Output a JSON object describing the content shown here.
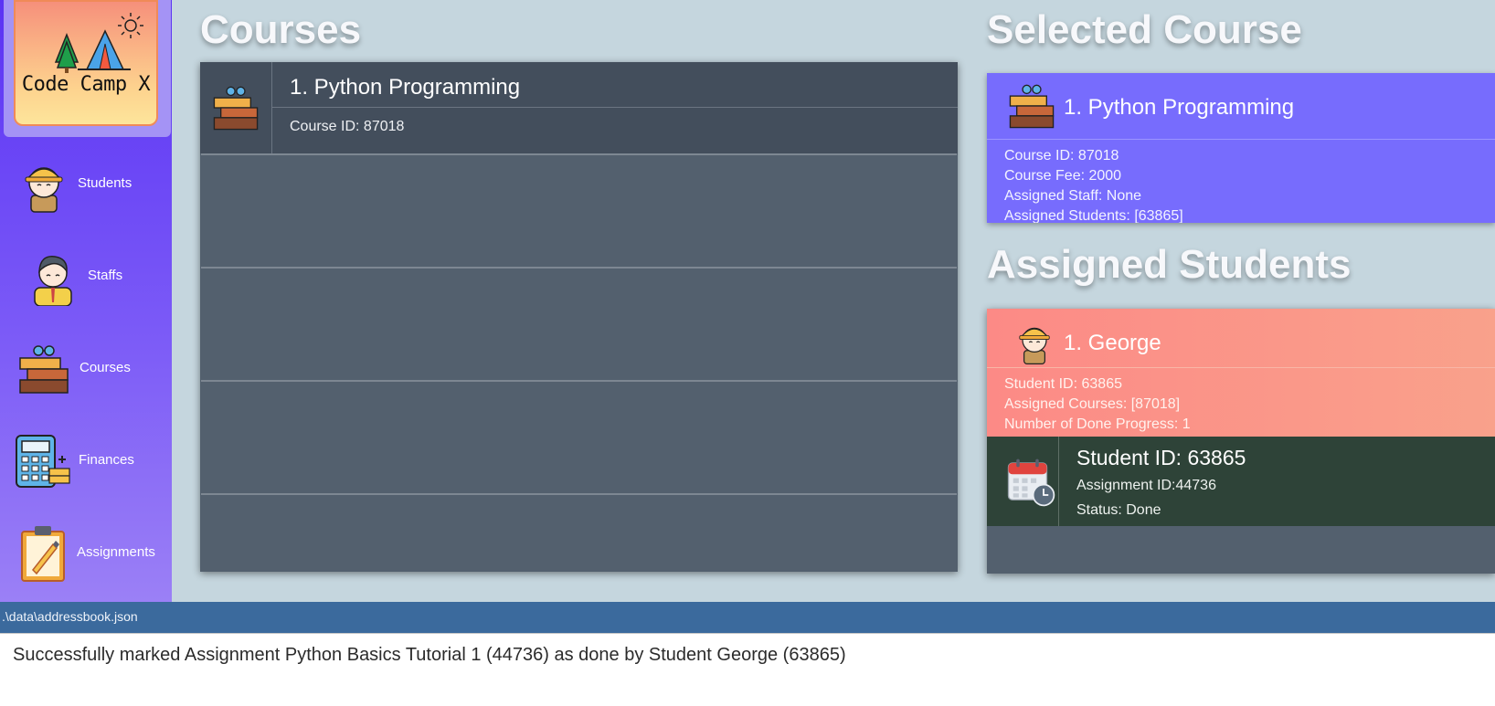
{
  "app": {
    "logo_text": "Code Camp X"
  },
  "sidebar": {
    "items": [
      {
        "label": "Students",
        "icon": "student-icon"
      },
      {
        "label": "Staffs",
        "icon": "staff-icon"
      },
      {
        "label": "Courses",
        "icon": "books-icon"
      },
      {
        "label": "Finances",
        "icon": "calculator-icon"
      },
      {
        "label": "Assignments",
        "icon": "clipboard-icon"
      }
    ]
  },
  "courses": {
    "heading": "Courses",
    "items": [
      {
        "title": "1. Python Programming",
        "course_id": "Course ID: 87018"
      }
    ]
  },
  "selected_course": {
    "heading": "Selected Course",
    "title": "1.  Python Programming",
    "details": [
      "Course ID: 87018",
      "Course Fee: 2000",
      "Assigned Staff: None",
      "Assigned Students: [63865]"
    ]
  },
  "assigned_students": {
    "heading": "Assigned Students",
    "student": {
      "title": "1.  George",
      "details": [
        "Student ID: 63865",
        "Assigned Courses: [87018]",
        "Number of Done Progress: 1"
      ]
    },
    "progress": {
      "title": "Student ID: 63865",
      "assignment": "Assignment ID:44736",
      "status": "Status: Done"
    }
  },
  "status_bar": {
    "path": ".\\data\\addressbook.json"
  },
  "result": {
    "message": "Successfully marked Assignment Python Basics Tutorial 1 (44736) as done by Student George (63865)"
  },
  "colors": {
    "sidebar_top": "#5b33f4",
    "course_card": "#434e5c",
    "selected_card": "#776cfd",
    "student_card": "#fc8a86",
    "progress_card": "#2e4338",
    "status_bar": "#3b6a9d"
  }
}
